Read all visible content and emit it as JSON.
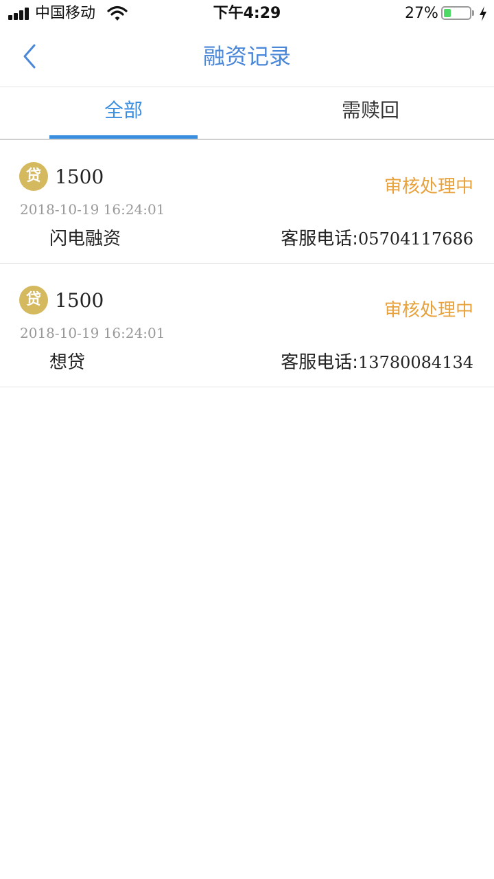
{
  "status_bar": {
    "carrier": "中国移动",
    "time": "下午4:29",
    "battery_percent": "27%",
    "battery_level": 0.27,
    "icons": [
      "signal-icon",
      "wifi-icon",
      "battery-icon",
      "charging-icon"
    ]
  },
  "nav": {
    "title": "融资记录",
    "back_icon": "chevron-left-icon"
  },
  "tabs": [
    {
      "label": "全部",
      "active": true
    },
    {
      "label": "需赎回",
      "active": false
    }
  ],
  "records": [
    {
      "badge": "贷",
      "amount": "1500",
      "status": "审核处理中",
      "date": "2018-10-19 16:24:01",
      "product": "闪电融资",
      "phone_label": "客服电话:",
      "phone": "05704117686"
    },
    {
      "badge": "贷",
      "amount": "1500",
      "status": "审核处理中",
      "date": "2018-10-19 16:24:01",
      "product": "想贷",
      "phone_label": "客服电话:",
      "phone": "13780084134"
    }
  ],
  "colors": {
    "accent_blue": "#3a8ee0",
    "title_blue": "#4a87d8",
    "status_orange": "#e8a23c",
    "badge_gold": "#d4b95f",
    "battery_green": "#4cd964"
  }
}
